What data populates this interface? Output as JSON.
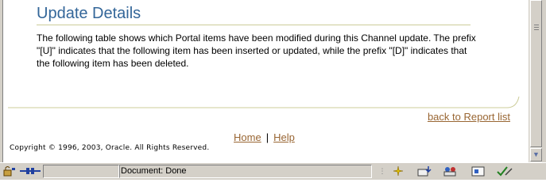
{
  "page": {
    "heading": "Update Details",
    "description": "The following table shows which Portal items have been modified during this Channel update. The prefix \"[U]\" indicates that the following item has been inserted or updated, while the prefix \"[D]\" indicates that the following item has been deleted.",
    "back_link": "back to Report list",
    "footer_links": {
      "home": "Home",
      "separator": "|",
      "help": "Help"
    },
    "copyright": "Copyright © 1996, 2003, Oracle. All Rights Reserved."
  },
  "statusbar": {
    "status_text": "Document: Done",
    "icons": [
      "lock-icon",
      "connection-icon",
      "sparkle-icon",
      "mail-download-icon",
      "people-icon",
      "card-icon",
      "checkmark-pen-icon"
    ]
  },
  "colors": {
    "heading": "#336699",
    "link": "#996633",
    "rule": "#cccc99",
    "chrome": "#d4d0c8"
  }
}
